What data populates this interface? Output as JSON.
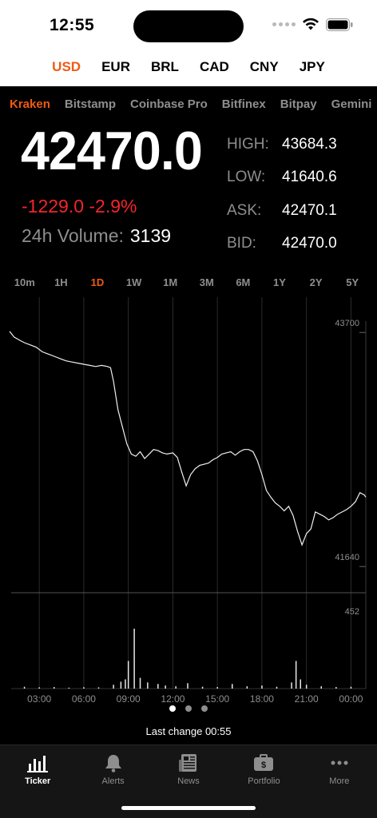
{
  "status": {
    "time": "12:55"
  },
  "currencies": [
    {
      "label": "USD",
      "active": true
    },
    {
      "label": "EUR",
      "active": false
    },
    {
      "label": "BRL",
      "active": false
    },
    {
      "label": "CAD",
      "active": false
    },
    {
      "label": "CNY",
      "active": false
    },
    {
      "label": "JPY",
      "active": false
    }
  ],
  "exchanges": [
    {
      "label": "Kraken",
      "active": true
    },
    {
      "label": "Bitstamp",
      "active": false
    },
    {
      "label": "Coinbase Pro",
      "active": false
    },
    {
      "label": "Bitfinex",
      "active": false
    },
    {
      "label": "Bitpay",
      "active": false
    },
    {
      "label": "Gemini",
      "active": false
    }
  ],
  "ticker": {
    "price": "42470.0",
    "change": "-1229.0 -2.9%",
    "volume_label": "24h Volume:",
    "volume_value": "3139",
    "high_label": "HIGH:",
    "high": "43684.3",
    "low_label": "LOW:",
    "low": "41640.6",
    "ask_label": "ASK:",
    "ask": "42470.1",
    "bid_label": "BID:",
    "bid": "42470.0"
  },
  "ranges": [
    {
      "label": "10m",
      "active": false
    },
    {
      "label": "1H",
      "active": false
    },
    {
      "label": "1D",
      "active": true
    },
    {
      "label": "1W",
      "active": false
    },
    {
      "label": "1M",
      "active": false
    },
    {
      "label": "3M",
      "active": false
    },
    {
      "label": "6M",
      "active": false
    },
    {
      "label": "1Y",
      "active": false
    },
    {
      "label": "2Y",
      "active": false
    },
    {
      "label": "5Y",
      "active": false
    }
  ],
  "chart_data": {
    "type": "line",
    "y_ticks": [
      "43700",
      "41640"
    ],
    "ylim": [
      41550,
      43800
    ],
    "volume_tick": "452",
    "volume_ylim": [
      0,
      520
    ],
    "x_ticks": [
      "03:00",
      "06:00",
      "09:00",
      "12:00",
      "15:00",
      "18:00",
      "21:00",
      "00:00"
    ],
    "x_tick_positions": [
      2,
      5,
      8,
      11,
      14,
      17,
      20,
      23
    ],
    "grid": true,
    "price_series": [
      [
        0.0,
        43640
      ],
      [
        0.3,
        43590
      ],
      [
        0.7,
        43560
      ],
      [
        1.0,
        43540
      ],
      [
        1.4,
        43520
      ],
      [
        1.8,
        43500
      ],
      [
        2.2,
        43460
      ],
      [
        2.6,
        43440
      ],
      [
        3.0,
        43420
      ],
      [
        3.4,
        43400
      ],
      [
        3.8,
        43380
      ],
      [
        4.2,
        43370
      ],
      [
        4.6,
        43360
      ],
      [
        5.0,
        43350
      ],
      [
        5.4,
        43340
      ],
      [
        5.8,
        43330
      ],
      [
        6.2,
        43340
      ],
      [
        6.6,
        43330
      ],
      [
        6.8,
        43320
      ],
      [
        7.0,
        43200
      ],
      [
        7.3,
        42950
      ],
      [
        7.6,
        42800
      ],
      [
        7.9,
        42650
      ],
      [
        8.2,
        42560
      ],
      [
        8.5,
        42540
      ],
      [
        8.8,
        42580
      ],
      [
        9.1,
        42520
      ],
      [
        9.4,
        42560
      ],
      [
        9.7,
        42600
      ],
      [
        10.0,
        42590
      ],
      [
        10.3,
        42570
      ],
      [
        10.6,
        42560
      ],
      [
        11.0,
        42570
      ],
      [
        11.3,
        42530
      ],
      [
        11.6,
        42400
      ],
      [
        11.9,
        42280
      ],
      [
        12.2,
        42380
      ],
      [
        12.5,
        42430
      ],
      [
        12.8,
        42460
      ],
      [
        13.1,
        42470
      ],
      [
        13.4,
        42480
      ],
      [
        13.7,
        42510
      ],
      [
        14.0,
        42530
      ],
      [
        14.3,
        42560
      ],
      [
        14.6,
        42570
      ],
      [
        14.9,
        42580
      ],
      [
        15.2,
        42550
      ],
      [
        15.5,
        42580
      ],
      [
        15.8,
        42600
      ],
      [
        16.1,
        42600
      ],
      [
        16.4,
        42580
      ],
      [
        16.7,
        42500
      ],
      [
        17.0,
        42380
      ],
      [
        17.3,
        42240
      ],
      [
        17.6,
        42180
      ],
      [
        17.9,
        42130
      ],
      [
        18.2,
        42100
      ],
      [
        18.5,
        42060
      ],
      [
        18.8,
        42100
      ],
      [
        19.1,
        42020
      ],
      [
        19.4,
        41880
      ],
      [
        19.7,
        41760
      ],
      [
        20.0,
        41860
      ],
      [
        20.3,
        41900
      ],
      [
        20.6,
        42050
      ],
      [
        20.9,
        42030
      ],
      [
        21.2,
        42010
      ],
      [
        21.5,
        41980
      ],
      [
        21.8,
        42000
      ],
      [
        22.1,
        42030
      ],
      [
        22.4,
        42050
      ],
      [
        22.7,
        42070
      ],
      [
        23.0,
        42100
      ],
      [
        23.3,
        42140
      ],
      [
        23.6,
        42220
      ],
      [
        23.9,
        42200
      ],
      [
        24.0,
        42180
      ]
    ],
    "volume_spikes": [
      [
        1.0,
        12
      ],
      [
        2.0,
        8
      ],
      [
        3.0,
        10
      ],
      [
        4.0,
        6
      ],
      [
        5.0,
        9
      ],
      [
        6.0,
        8
      ],
      [
        7.0,
        25
      ],
      [
        7.5,
        45
      ],
      [
        7.8,
        60
      ],
      [
        8.0,
        180
      ],
      [
        8.4,
        390
      ],
      [
        8.8,
        70
      ],
      [
        9.3,
        40
      ],
      [
        10.0,
        30
      ],
      [
        10.5,
        20
      ],
      [
        11.2,
        15
      ],
      [
        12.0,
        35
      ],
      [
        13.0,
        12
      ],
      [
        14.0,
        10
      ],
      [
        15.0,
        30
      ],
      [
        16.0,
        15
      ],
      [
        17.0,
        20
      ],
      [
        18.0,
        12
      ],
      [
        19.0,
        40
      ],
      [
        19.3,
        180
      ],
      [
        19.6,
        60
      ],
      [
        20.0,
        25
      ],
      [
        21.0,
        15
      ],
      [
        22.0,
        10
      ],
      [
        23.0,
        12
      ]
    ]
  },
  "pager": {
    "count": 3,
    "active": 0
  },
  "last_change": "Last change 00:55",
  "tabs": [
    {
      "label": "Ticker",
      "icon": "chart-bars-icon",
      "active": true
    },
    {
      "label": "Alerts",
      "icon": "bell-icon",
      "active": false
    },
    {
      "label": "News",
      "icon": "newspaper-icon",
      "active": false
    },
    {
      "label": "Portfolio",
      "icon": "briefcase-dollar-icon",
      "active": false
    },
    {
      "label": "More",
      "icon": "ellipsis-icon",
      "active": false
    }
  ],
  "colors": {
    "accent": "#f05a13",
    "negative": "#f4252b",
    "muted": "#8e8e8e"
  }
}
